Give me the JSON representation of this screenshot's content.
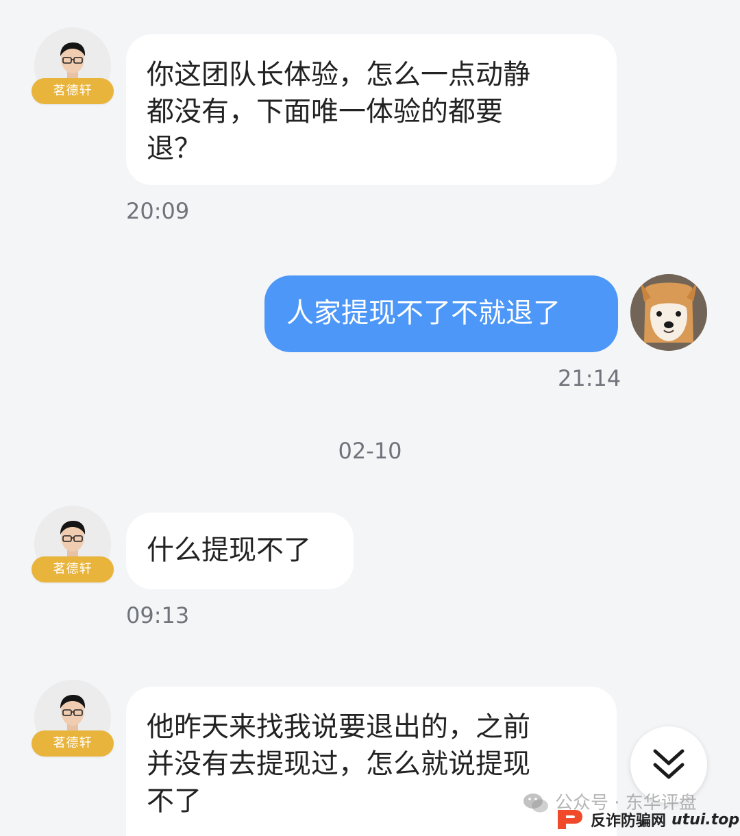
{
  "messages": [
    {
      "sender_name": "茗德轩",
      "text": "你这团队长体验，怎么一点动静\n都没有，下面唯一体验的都要\n退？",
      "time": "20:09"
    },
    {
      "text": "人家提现不了不就退了",
      "time": "21:14"
    },
    {
      "sender_name": "茗德轩",
      "text": "什么提现不了",
      "time": "09:13"
    },
    {
      "sender_name": "茗德轩",
      "text": "他昨天来找我说要退出的，之前\n并没有去提现过，怎么就说提现\n不了"
    }
  ],
  "date_separator": "02-10",
  "watermark": {
    "account_text": "公众号 · 东华评盘",
    "brand_text": "反诈防骗网",
    "brand_site": "utui.top"
  },
  "icons": {
    "scroll_down": "double-chevron-down-icon",
    "wechat": "wechat-icon",
    "brand_logo": "brand-logo-icon"
  },
  "colors": {
    "background": "#f4f5f7",
    "incoming_bubble": "#ffffff",
    "outgoing_bubble": "#4c97f7",
    "name_badge": "#e9b43c",
    "timestamp": "#6f737a"
  }
}
